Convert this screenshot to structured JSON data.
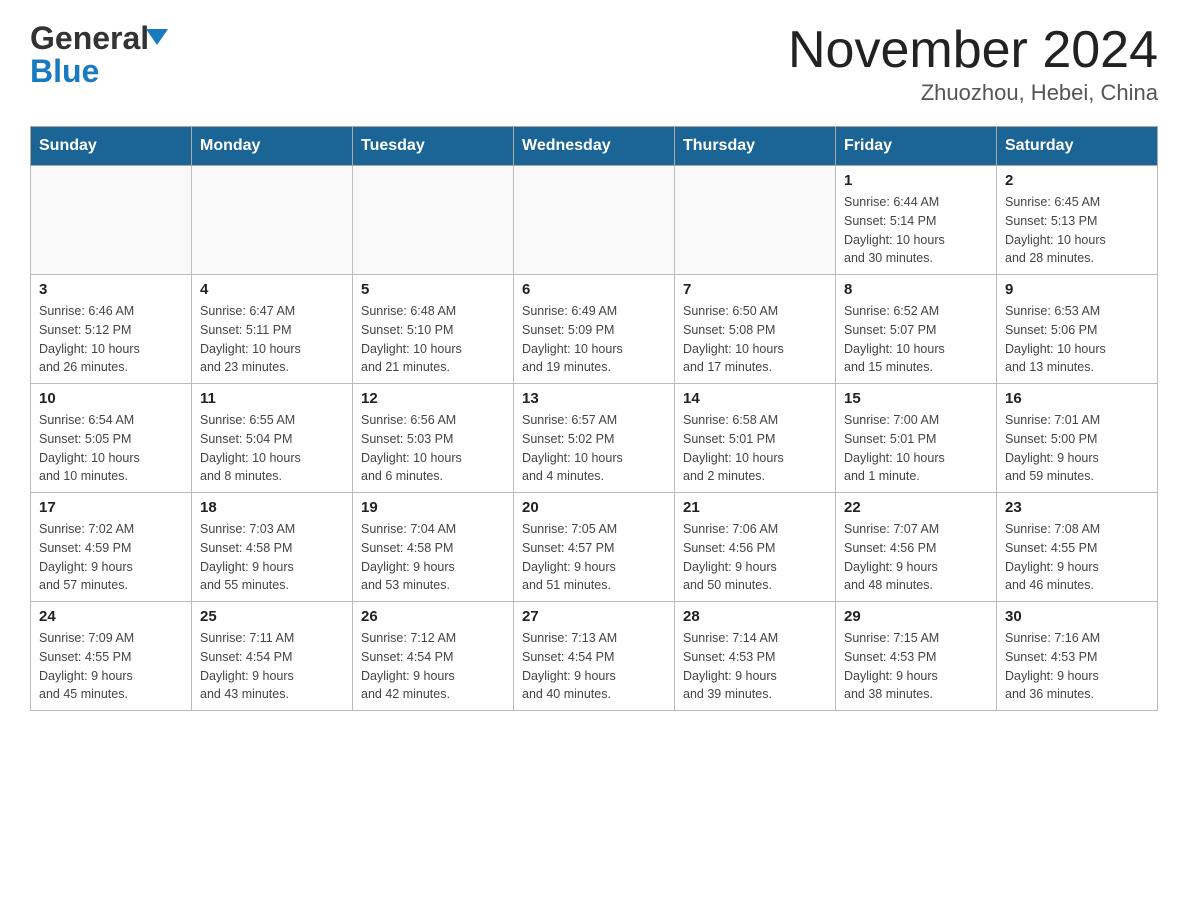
{
  "header": {
    "logo_general": "General",
    "logo_blue": "Blue",
    "title": "November 2024",
    "subtitle": "Zhuozhou, Hebei, China"
  },
  "weekdays": [
    "Sunday",
    "Monday",
    "Tuesday",
    "Wednesday",
    "Thursday",
    "Friday",
    "Saturday"
  ],
  "weeks": [
    [
      {
        "day": "",
        "info": ""
      },
      {
        "day": "",
        "info": ""
      },
      {
        "day": "",
        "info": ""
      },
      {
        "day": "",
        "info": ""
      },
      {
        "day": "",
        "info": ""
      },
      {
        "day": "1",
        "info": "Sunrise: 6:44 AM\nSunset: 5:14 PM\nDaylight: 10 hours\nand 30 minutes."
      },
      {
        "day": "2",
        "info": "Sunrise: 6:45 AM\nSunset: 5:13 PM\nDaylight: 10 hours\nand 28 minutes."
      }
    ],
    [
      {
        "day": "3",
        "info": "Sunrise: 6:46 AM\nSunset: 5:12 PM\nDaylight: 10 hours\nand 26 minutes."
      },
      {
        "day": "4",
        "info": "Sunrise: 6:47 AM\nSunset: 5:11 PM\nDaylight: 10 hours\nand 23 minutes."
      },
      {
        "day": "5",
        "info": "Sunrise: 6:48 AM\nSunset: 5:10 PM\nDaylight: 10 hours\nand 21 minutes."
      },
      {
        "day": "6",
        "info": "Sunrise: 6:49 AM\nSunset: 5:09 PM\nDaylight: 10 hours\nand 19 minutes."
      },
      {
        "day": "7",
        "info": "Sunrise: 6:50 AM\nSunset: 5:08 PM\nDaylight: 10 hours\nand 17 minutes."
      },
      {
        "day": "8",
        "info": "Sunrise: 6:52 AM\nSunset: 5:07 PM\nDaylight: 10 hours\nand 15 minutes."
      },
      {
        "day": "9",
        "info": "Sunrise: 6:53 AM\nSunset: 5:06 PM\nDaylight: 10 hours\nand 13 minutes."
      }
    ],
    [
      {
        "day": "10",
        "info": "Sunrise: 6:54 AM\nSunset: 5:05 PM\nDaylight: 10 hours\nand 10 minutes."
      },
      {
        "day": "11",
        "info": "Sunrise: 6:55 AM\nSunset: 5:04 PM\nDaylight: 10 hours\nand 8 minutes."
      },
      {
        "day": "12",
        "info": "Sunrise: 6:56 AM\nSunset: 5:03 PM\nDaylight: 10 hours\nand 6 minutes."
      },
      {
        "day": "13",
        "info": "Sunrise: 6:57 AM\nSunset: 5:02 PM\nDaylight: 10 hours\nand 4 minutes."
      },
      {
        "day": "14",
        "info": "Sunrise: 6:58 AM\nSunset: 5:01 PM\nDaylight: 10 hours\nand 2 minutes."
      },
      {
        "day": "15",
        "info": "Sunrise: 7:00 AM\nSunset: 5:01 PM\nDaylight: 10 hours\nand 1 minute."
      },
      {
        "day": "16",
        "info": "Sunrise: 7:01 AM\nSunset: 5:00 PM\nDaylight: 9 hours\nand 59 minutes."
      }
    ],
    [
      {
        "day": "17",
        "info": "Sunrise: 7:02 AM\nSunset: 4:59 PM\nDaylight: 9 hours\nand 57 minutes."
      },
      {
        "day": "18",
        "info": "Sunrise: 7:03 AM\nSunset: 4:58 PM\nDaylight: 9 hours\nand 55 minutes."
      },
      {
        "day": "19",
        "info": "Sunrise: 7:04 AM\nSunset: 4:58 PM\nDaylight: 9 hours\nand 53 minutes."
      },
      {
        "day": "20",
        "info": "Sunrise: 7:05 AM\nSunset: 4:57 PM\nDaylight: 9 hours\nand 51 minutes."
      },
      {
        "day": "21",
        "info": "Sunrise: 7:06 AM\nSunset: 4:56 PM\nDaylight: 9 hours\nand 50 minutes."
      },
      {
        "day": "22",
        "info": "Sunrise: 7:07 AM\nSunset: 4:56 PM\nDaylight: 9 hours\nand 48 minutes."
      },
      {
        "day": "23",
        "info": "Sunrise: 7:08 AM\nSunset: 4:55 PM\nDaylight: 9 hours\nand 46 minutes."
      }
    ],
    [
      {
        "day": "24",
        "info": "Sunrise: 7:09 AM\nSunset: 4:55 PM\nDaylight: 9 hours\nand 45 minutes."
      },
      {
        "day": "25",
        "info": "Sunrise: 7:11 AM\nSunset: 4:54 PM\nDaylight: 9 hours\nand 43 minutes."
      },
      {
        "day": "26",
        "info": "Sunrise: 7:12 AM\nSunset: 4:54 PM\nDaylight: 9 hours\nand 42 minutes."
      },
      {
        "day": "27",
        "info": "Sunrise: 7:13 AM\nSunset: 4:54 PM\nDaylight: 9 hours\nand 40 minutes."
      },
      {
        "day": "28",
        "info": "Sunrise: 7:14 AM\nSunset: 4:53 PM\nDaylight: 9 hours\nand 39 minutes."
      },
      {
        "day": "29",
        "info": "Sunrise: 7:15 AM\nSunset: 4:53 PM\nDaylight: 9 hours\nand 38 minutes."
      },
      {
        "day": "30",
        "info": "Sunrise: 7:16 AM\nSunset: 4:53 PM\nDaylight: 9 hours\nand 36 minutes."
      }
    ]
  ]
}
